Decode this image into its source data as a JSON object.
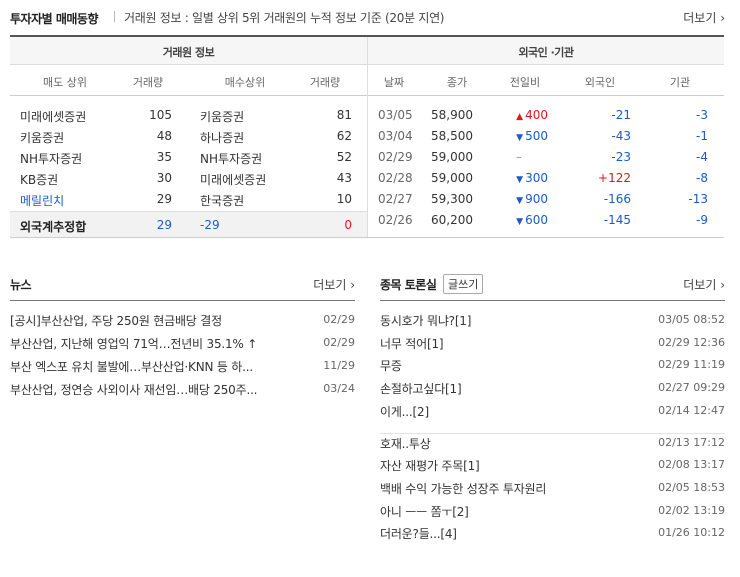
{
  "top": {
    "title": "투자자별 매매동향",
    "description": "거래원 정보 : 일별 상위 5위 거래원의 누적 정보 기준 (20분 지연)",
    "more": "더보기"
  },
  "broker": {
    "group_title": "거래원 정보",
    "headers": [
      "매도 상위",
      "거래량",
      "매수상위",
      "거래량"
    ],
    "rows": [
      {
        "sell": "미래에셋증권",
        "sell_vol": "105",
        "buy": "키움증권",
        "buy_vol": "81",
        "sell_blue": false
      },
      {
        "sell": "키움증권",
        "sell_vol": "48",
        "buy": "하나증권",
        "buy_vol": "62",
        "sell_blue": false
      },
      {
        "sell": "NH투자증권",
        "sell_vol": "35",
        "buy": "NH투자증권",
        "buy_vol": "52",
        "sell_blue": false
      },
      {
        "sell": "KB증권",
        "sell_vol": "30",
        "buy": "미래에셋증권",
        "buy_vol": "43",
        "sell_blue": false
      },
      {
        "sell": "메릴린치",
        "sell_vol": "29",
        "buy": "한국증권",
        "buy_vol": "10",
        "sell_blue": true
      }
    ],
    "total": {
      "label": "외국계추정합",
      "sell_vol": "29",
      "buy_vol": "-29",
      "net": "0"
    }
  },
  "foreign": {
    "group_title": "외국인 ·기관",
    "headers": [
      "날짜",
      "종가",
      "전일비",
      "외국인",
      "기관"
    ],
    "rows": [
      {
        "date": "03/05",
        "close": "58,900",
        "dir": "up",
        "change": "400",
        "foreign": "-21",
        "inst": "-3"
      },
      {
        "date": "03/04",
        "close": "58,500",
        "dir": "down",
        "change": "500",
        "foreign": "-43",
        "inst": "-1"
      },
      {
        "date": "02/29",
        "close": "59,000",
        "dir": "none",
        "change": "",
        "foreign": "-23",
        "inst": "-4"
      },
      {
        "date": "02/28",
        "close": "59,000",
        "dir": "down",
        "change": "300",
        "foreign": "+122",
        "inst": "-8"
      },
      {
        "date": "02/27",
        "close": "59,300",
        "dir": "down",
        "change": "900",
        "foreign": "-166",
        "inst": "-13"
      },
      {
        "date": "02/26",
        "close": "60,200",
        "dir": "down",
        "change": "600",
        "foreign": "-145",
        "inst": "-9"
      }
    ]
  },
  "news": {
    "title": "뉴스",
    "more": "더보기",
    "items": [
      {
        "title": "[공시]부산산업, 주당 250원 현금배당 결정",
        "date": "02/29"
      },
      {
        "title": "부산산업, 지난해 영업익 71억…전년비 35.1% ↑",
        "date": "02/29"
      },
      {
        "title": "부산 엑스포 유치 불발에…부산산업·KNN 등 하...",
        "date": "11/29"
      },
      {
        "title": "부산산업, 정연승 사외이사 재선임…배당 250주...",
        "date": "03/24"
      }
    ]
  },
  "board": {
    "title": "종목 토론실",
    "write": "글쓰기",
    "more": "더보기",
    "items": [
      {
        "title": "동시호가 뭐냐?[1]",
        "date": "03/05 08:52"
      },
      {
        "title": "너무 적어[1]",
        "date": "02/29 12:36"
      },
      {
        "title": "무증",
        "date": "02/29 11:19"
      },
      {
        "title": "손절하고싶다[1]",
        "date": "02/27 09:29"
      },
      {
        "title": "이게...[2]",
        "date": "02/14 12:47"
      },
      {
        "title": "호재..투상",
        "date": "02/13 17:12"
      },
      {
        "title": "자산 재평가 주목[1]",
        "date": "02/08 13:17"
      },
      {
        "title": "백배 수익 가능한 성장주 투자원리",
        "date": "02/05 18:53"
      },
      {
        "title": "아니 ㅡㅡ 쫌ㅜ[2]",
        "date": "02/02 13:19"
      },
      {
        "title": "더러운?들...[4]",
        "date": "01/26 10:12"
      }
    ]
  }
}
